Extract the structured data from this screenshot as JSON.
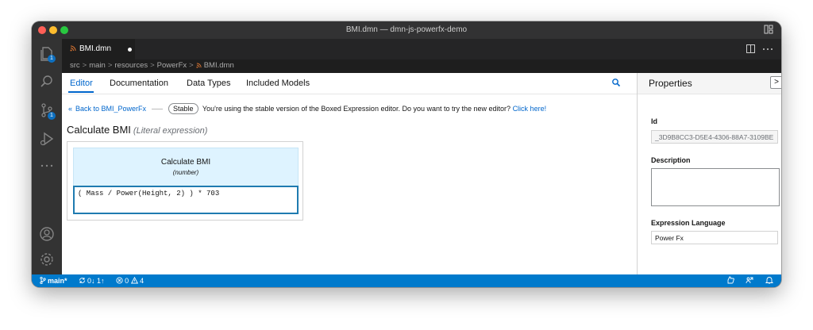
{
  "window": {
    "title": "BMI.dmn — dmn-js-powerfx-demo"
  },
  "tab": {
    "label": "BMI.dmn"
  },
  "breadcrumb": {
    "items": [
      {
        "label": "src"
      },
      {
        "label": "main"
      },
      {
        "label": "resources"
      },
      {
        "label": "PowerFx"
      },
      {
        "label": "BMI.dmn"
      }
    ],
    "separator": ">"
  },
  "activity_bar": {
    "explorer_badge": "1",
    "scm_badge": "1"
  },
  "editor": {
    "tabs": [
      {
        "label": "Editor"
      },
      {
        "label": "Documentation"
      },
      {
        "label": "Data Types"
      },
      {
        "label": "Included Models"
      }
    ],
    "notice": {
      "back_arrow": "«",
      "back_label": "Back to BMI_PowerFx",
      "stable_label": "Stable",
      "message": "You're using the stable version of the Boxed Expression editor. Do you want to try the new editor?",
      "click_here": "Click here!"
    },
    "expression": {
      "title": "Calculate BMI",
      "subtitle": "(Literal expression)",
      "header_name": "Calculate BMI",
      "header_type": "(number)",
      "code": "( Mass / Power(Height, 2) ) * 703"
    }
  },
  "properties": {
    "title": "Properties",
    "close_glyph": ">",
    "id_label": "Id",
    "id_value": "_3D9B8CC3-D5E4-4306-88A7-3109BE",
    "description_label": "Description",
    "description_value": "",
    "language_label": "Expression Language",
    "language_value": "Power Fx"
  },
  "status_bar": {
    "branch": "main*",
    "sync": "0↓ 1↑",
    "errors": "0",
    "warnings": "4"
  },
  "colors": {
    "accent": "#0066cc",
    "status_bar": "#007acc",
    "header_blue": "#def3ff",
    "titlebar": "#323233",
    "activity_bar": "#333333"
  }
}
